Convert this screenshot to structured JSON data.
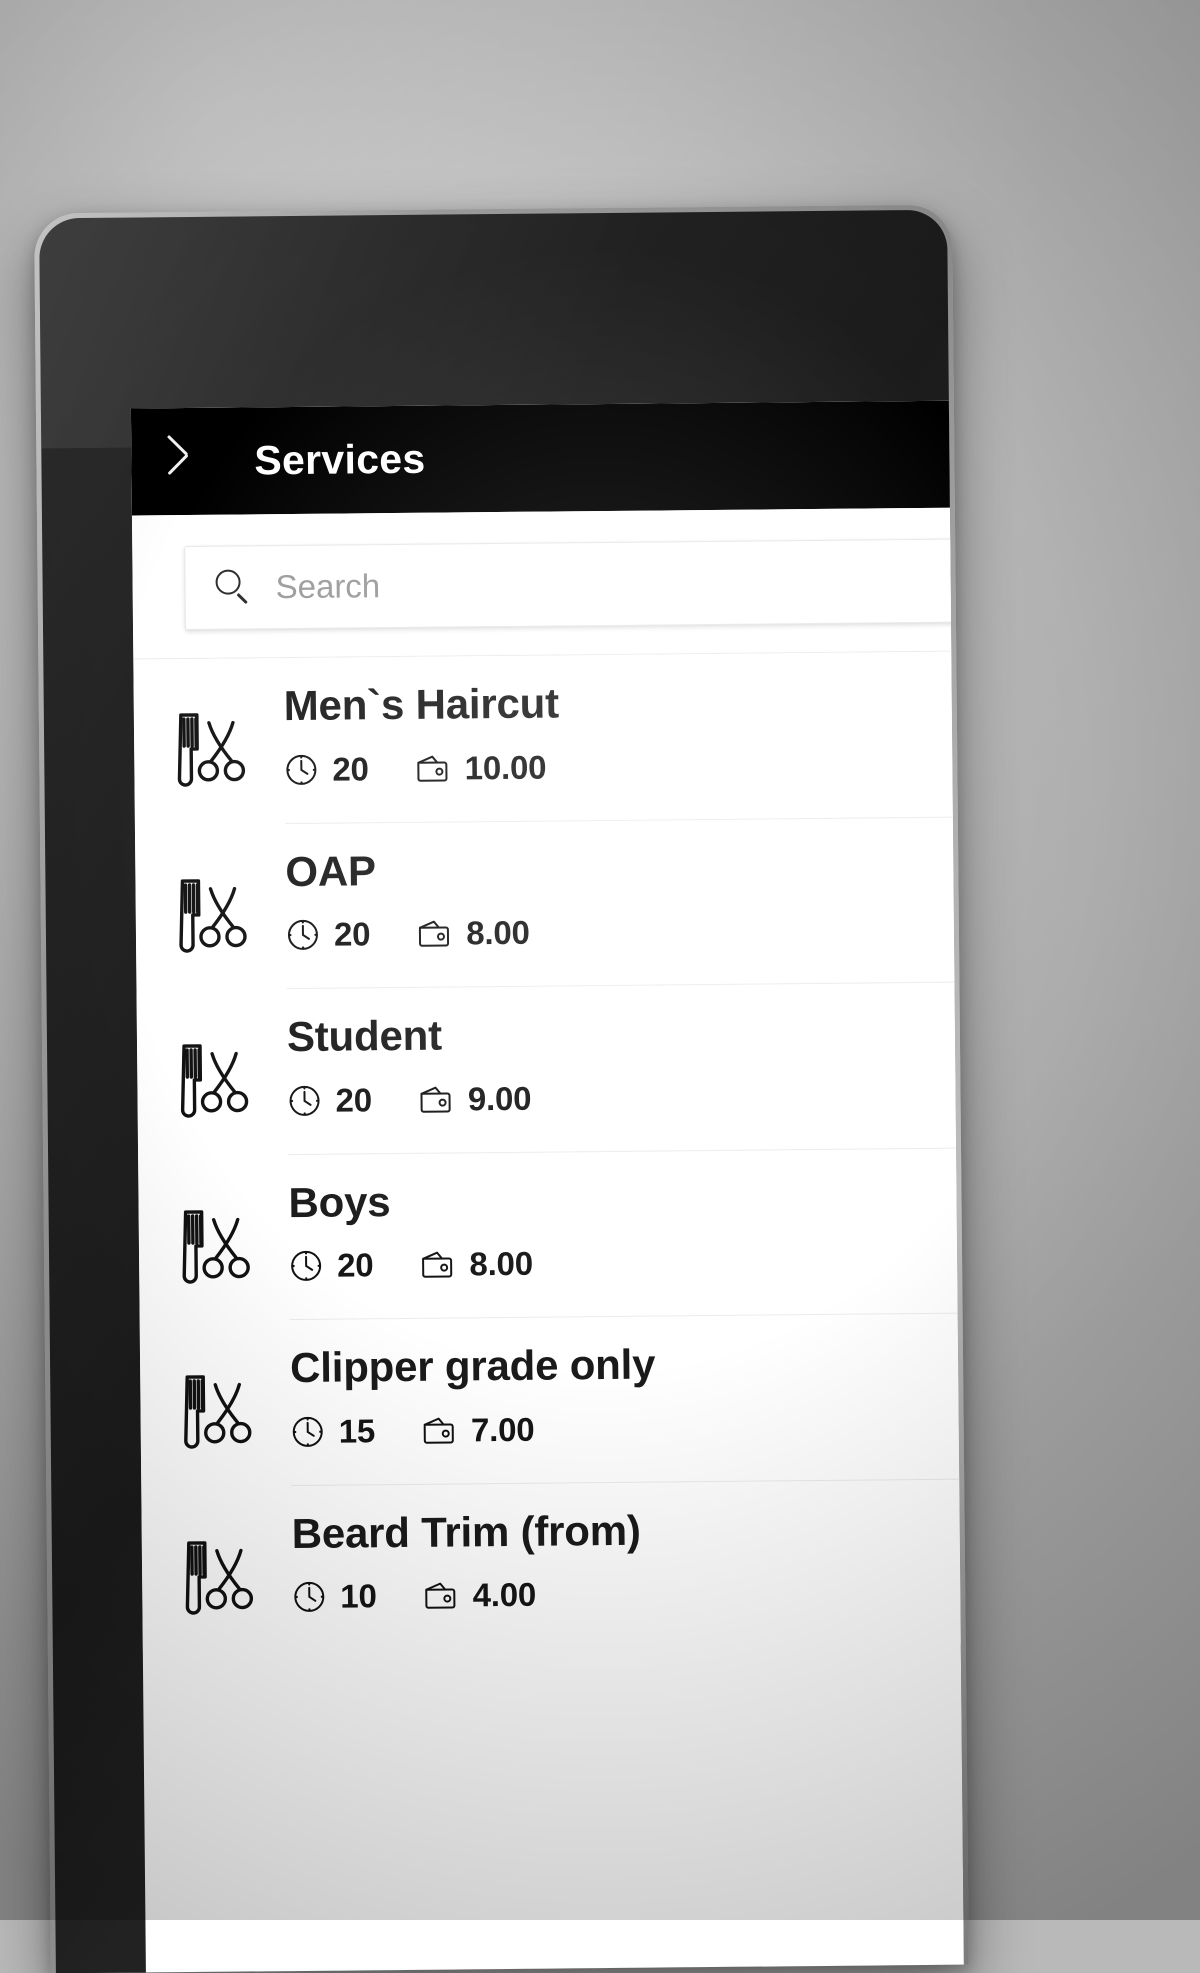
{
  "app": {
    "header": {
      "back_icon": "chevron-left-icon",
      "title": "Services"
    },
    "search": {
      "icon": "search-icon",
      "placeholder": "Search",
      "value": ""
    },
    "list": {
      "item_icon": "comb-scissors-icon",
      "duration_icon": "clock-icon",
      "price_icon": "wallet-icon",
      "items": [
        {
          "name": "Men`s Haircut",
          "duration": "20",
          "price": "10.00"
        },
        {
          "name": "OAP",
          "duration": "20",
          "price": "8.00"
        },
        {
          "name": "Student",
          "duration": "20",
          "price": "9.00"
        },
        {
          "name": "Boys",
          "duration": "20",
          "price": "8.00"
        },
        {
          "name": "Clipper grade only",
          "duration": "15",
          "price": "7.00"
        },
        {
          "name": "Beard Trim (from)",
          "duration": "10",
          "price": "4.00"
        }
      ]
    }
  },
  "device": {
    "camera_icon": "front-camera-icon"
  },
  "colors": {
    "appbar_bg": "#000000",
    "appbar_text": "#ffffff",
    "screen_bg": "#ffffff",
    "title_text": "#1a1a1a",
    "meta_text": "#151515",
    "placeholder_text": "#9b9b9b",
    "divider": "#ececec"
  }
}
